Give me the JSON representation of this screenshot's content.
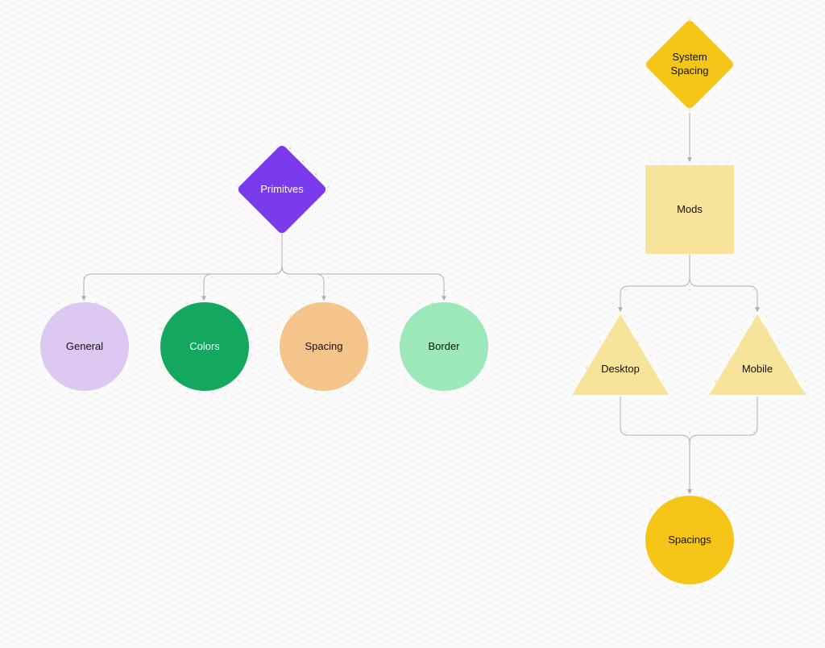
{
  "left": {
    "root": {
      "label": "Primitves",
      "text_color": "#ffffff",
      "fill": "#7c3aed"
    },
    "children": [
      {
        "label": "General",
        "fill": "#dcc8f0",
        "text_color": "#111111"
      },
      {
        "label": "Colors",
        "fill": "#14a85e",
        "text_color": "#ffffff"
      },
      {
        "label": "Spacing",
        "fill": "#f5c48a",
        "text_color": "#111111"
      },
      {
        "label": "Border",
        "fill": "#9ce8b8",
        "text_color": "#111111"
      }
    ]
  },
  "right": {
    "root": {
      "label": "System\nSpacing",
      "fill": "#f5c518",
      "text_color": "#111111"
    },
    "mods": {
      "label": "Mods",
      "fill": "#f8e39a",
      "text_color": "#111111"
    },
    "branches": [
      {
        "label": "Desktop",
        "fill": "#f8e39a",
        "text_color": "#111111"
      },
      {
        "label": "Mobile",
        "fill": "#f8e39a",
        "text_color": "#111111"
      }
    ],
    "leaf": {
      "label": "Spacings",
      "fill": "#f5c518",
      "text_color": "#111111"
    }
  },
  "colors": {
    "connector": "#b0b0b0"
  }
}
